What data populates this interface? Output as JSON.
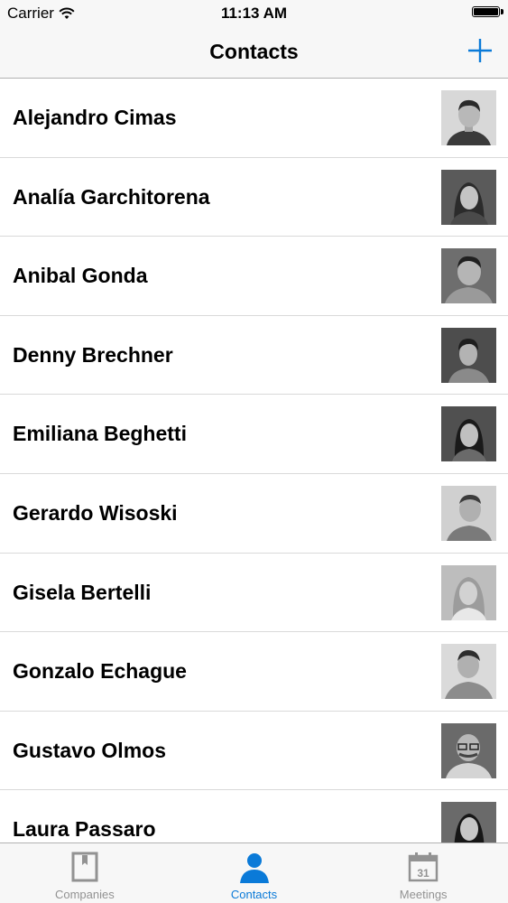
{
  "status_bar": {
    "carrier": "Carrier",
    "time": "11:13 AM"
  },
  "nav": {
    "title": "Contacts",
    "add_icon": "plus-icon"
  },
  "contacts": [
    {
      "name": "Alejandro Cimas"
    },
    {
      "name": "Analía Garchitorena"
    },
    {
      "name": "Anibal Gonda"
    },
    {
      "name": "Denny Brechner"
    },
    {
      "name": "Emiliana Beghetti"
    },
    {
      "name": "Gerardo Wisoski"
    },
    {
      "name": "Gisela Bertelli"
    },
    {
      "name": "Gonzalo Echague"
    },
    {
      "name": "Gustavo Olmos"
    },
    {
      "name": "Laura Passaro"
    }
  ],
  "tab_bar": {
    "tabs": [
      {
        "label": "Companies",
        "icon": "book-icon",
        "active": false
      },
      {
        "label": "Contacts",
        "icon": "person-icon",
        "active": true
      },
      {
        "label": "Meetings",
        "icon": "calendar-icon",
        "active": false
      }
    ],
    "calendar_day": "31"
  },
  "colors": {
    "accent": "#0a7ad8",
    "inactive": "#929292",
    "bar_background": "#f7f7f7"
  }
}
